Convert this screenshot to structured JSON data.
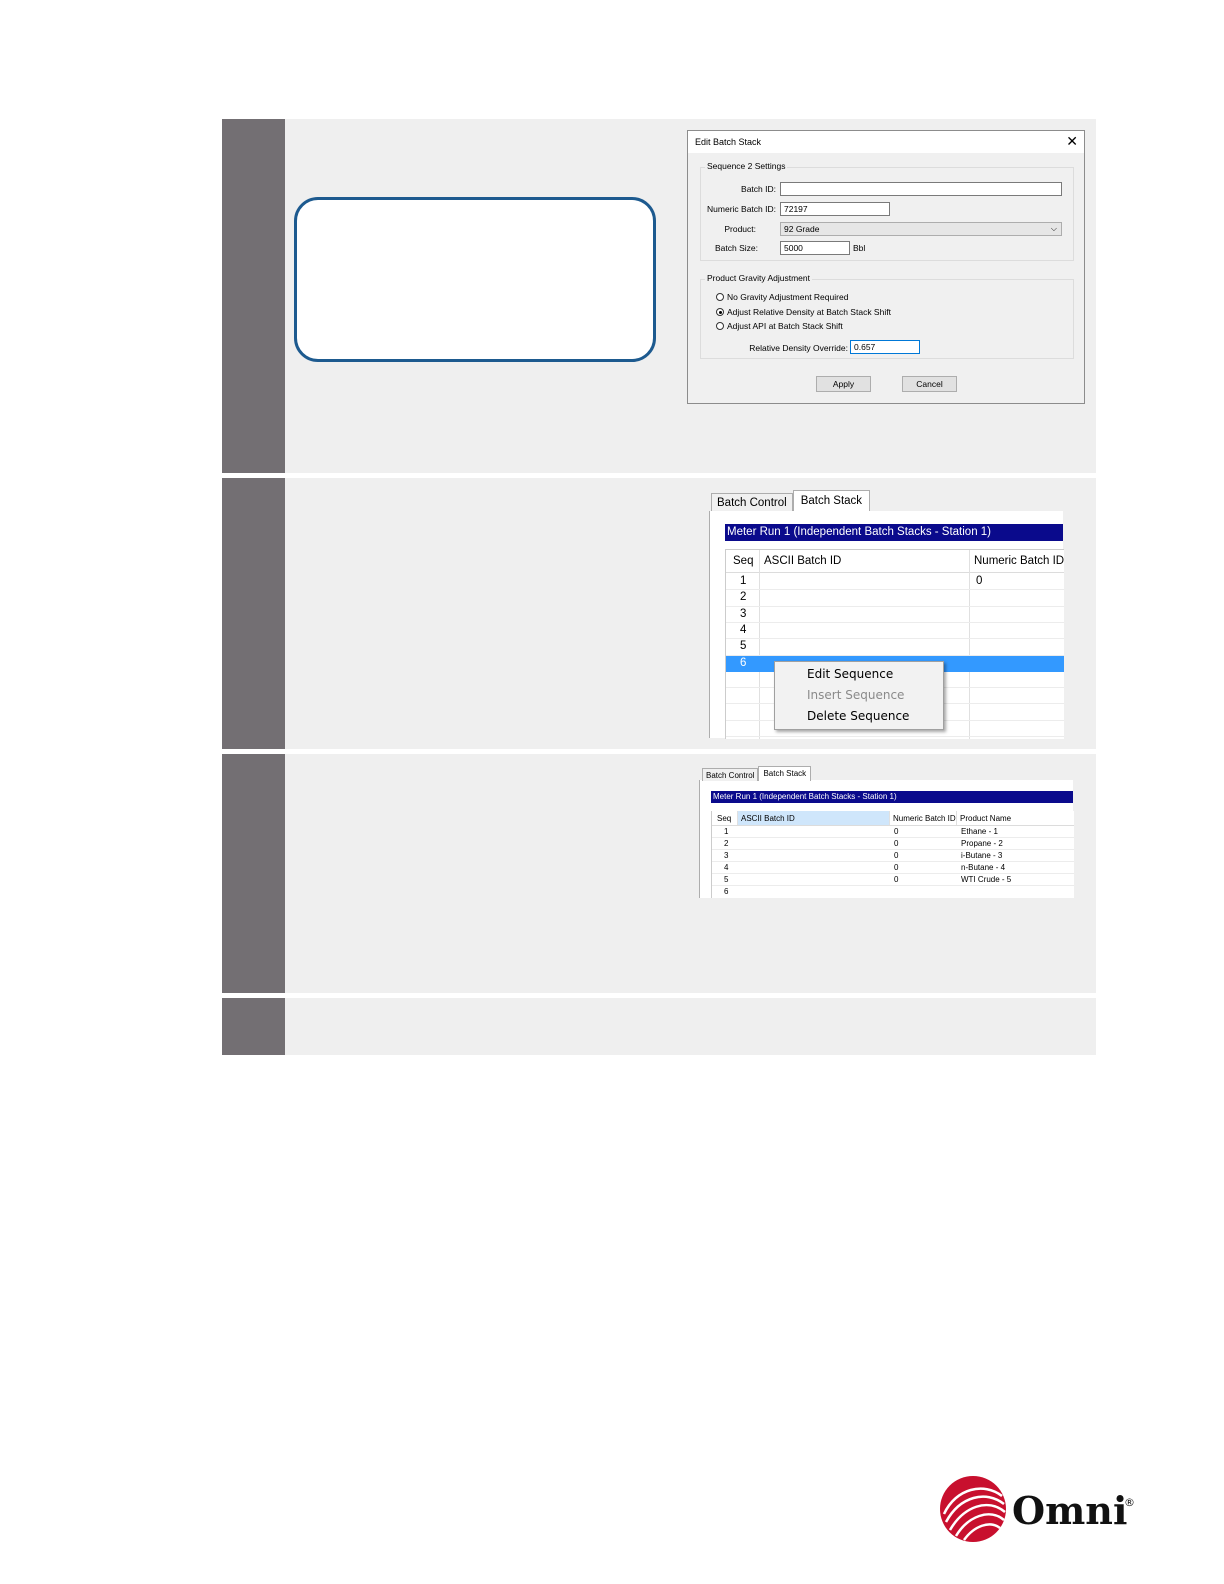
{
  "dialog": {
    "title": "Edit Batch Stack",
    "close_glyph": "✕",
    "group1_title": "Sequence 2 Settings",
    "batch_id_label": "Batch ID:",
    "batch_id_value": "",
    "numeric_batch_id_label": "Numeric Batch ID:",
    "numeric_batch_id_value": "72197",
    "product_label": "Product:",
    "product_value": "92 Grade",
    "batch_size_label": "Batch Size:",
    "batch_size_value": "5000",
    "batch_size_unit": "Bbl",
    "group2_title": "Product Gravity Adjustment",
    "radio1": "No Gravity Adjustment Required",
    "radio2": "Adjust Relative Density at Batch Stack Shift",
    "radio3": "Adjust API at Batch Stack Shift",
    "override_label": "Relative Density Override:",
    "override_value": "0.657",
    "apply": "Apply",
    "cancel": "Cancel"
  },
  "stack1": {
    "tab_control": "Batch Control",
    "tab_stack": "Batch Stack",
    "title": "Meter Run 1 (Independent Batch Stacks - Station 1)",
    "col_seq": "Seq",
    "col_ascii": "ASCII Batch ID",
    "col_numeric": "Numeric Batch ID",
    "rows": [
      {
        "seq": "1",
        "numeric": "0"
      },
      {
        "seq": "2",
        "numeric": ""
      },
      {
        "seq": "3",
        "numeric": ""
      },
      {
        "seq": "4",
        "numeric": ""
      },
      {
        "seq": "5",
        "numeric": ""
      },
      {
        "seq": "6",
        "numeric": ""
      }
    ],
    "menu": [
      "Edit Sequence",
      "Insert Sequence",
      "Delete Sequence"
    ]
  },
  "stack2": {
    "tab_control": "Batch Control",
    "tab_stack": "Batch Stack",
    "title": "Meter Run 1 (Independent Batch Stacks - Station 1)",
    "col_seq": "Seq",
    "col_ascii": "ASCII Batch ID",
    "col_numeric": "Numeric Batch ID",
    "col_product": "Product Name",
    "rows": [
      {
        "seq": "1",
        "numeric": "0",
        "product": "Ethane - 1"
      },
      {
        "seq": "2",
        "numeric": "0",
        "product": "Propane - 2"
      },
      {
        "seq": "3",
        "numeric": "0",
        "product": "i-Butane - 3"
      },
      {
        "seq": "4",
        "numeric": "0",
        "product": "n-Butane - 4"
      },
      {
        "seq": "5",
        "numeric": "0",
        "product": "WTI Crude - 5"
      },
      {
        "seq": "6",
        "numeric": "",
        "product": ""
      }
    ]
  },
  "logo": {
    "text": "Omni",
    "registered": "®"
  },
  "colors": {
    "sidebar": "#736f73",
    "row_bg": "#efefef",
    "callout_border": "#1d5a8f",
    "title_bar": "#0a0a8c",
    "selection": "#3399ff",
    "logo_red": "#c8102e"
  }
}
